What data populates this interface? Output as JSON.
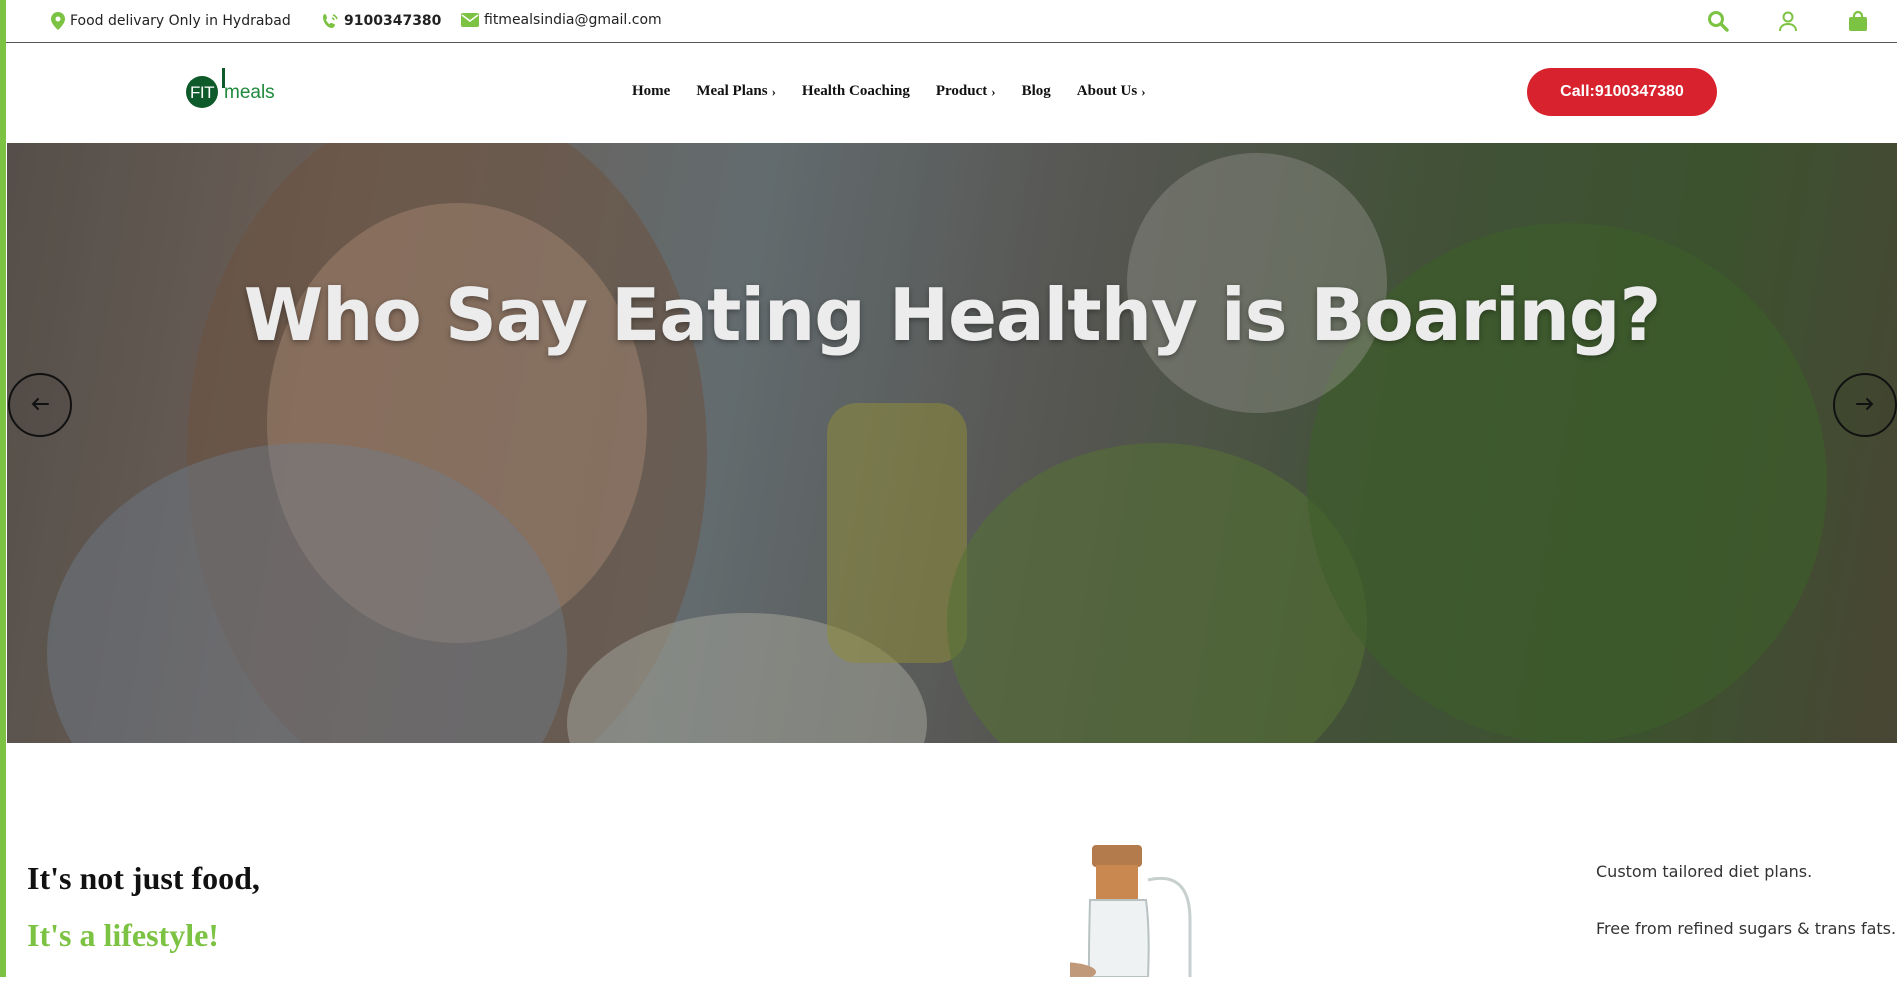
{
  "topbar": {
    "delivery_text": "Food delivary Only in Hydrabad",
    "phone": "9100347380",
    "email": "fitmealsindia@gmail.com",
    "icons": [
      "location-pin-icon",
      "phone-icon",
      "mail-icon",
      "search-icon",
      "user-icon",
      "shopping-bag-icon"
    ],
    "accent": "#7cc243"
  },
  "header": {
    "logo": {
      "fit": "FIT",
      "meals": "meals"
    },
    "nav": [
      {
        "label": "Home"
      },
      {
        "label": "Meal Plans",
        "chevron": "›"
      },
      {
        "label": "Health Coaching"
      },
      {
        "label": "Product",
        "chevron": "›"
      },
      {
        "label": "Blog"
      },
      {
        "label": "About Us",
        "chevron": "›"
      }
    ],
    "call_button": "Call:9100347380",
    "call_color": "#d8232f"
  },
  "hero": {
    "title": "Who Say Eating Healthy is Boaring?",
    "prev_icon": "arrow-left-icon",
    "next_icon": "arrow-right-icon"
  },
  "intro": {
    "heading_line1": "It's not just food,",
    "heading_line2": "It's a lifestyle!",
    "features": [
      "Custom tailored diet plans.",
      "Free from refined sugars & trans fats."
    ]
  }
}
